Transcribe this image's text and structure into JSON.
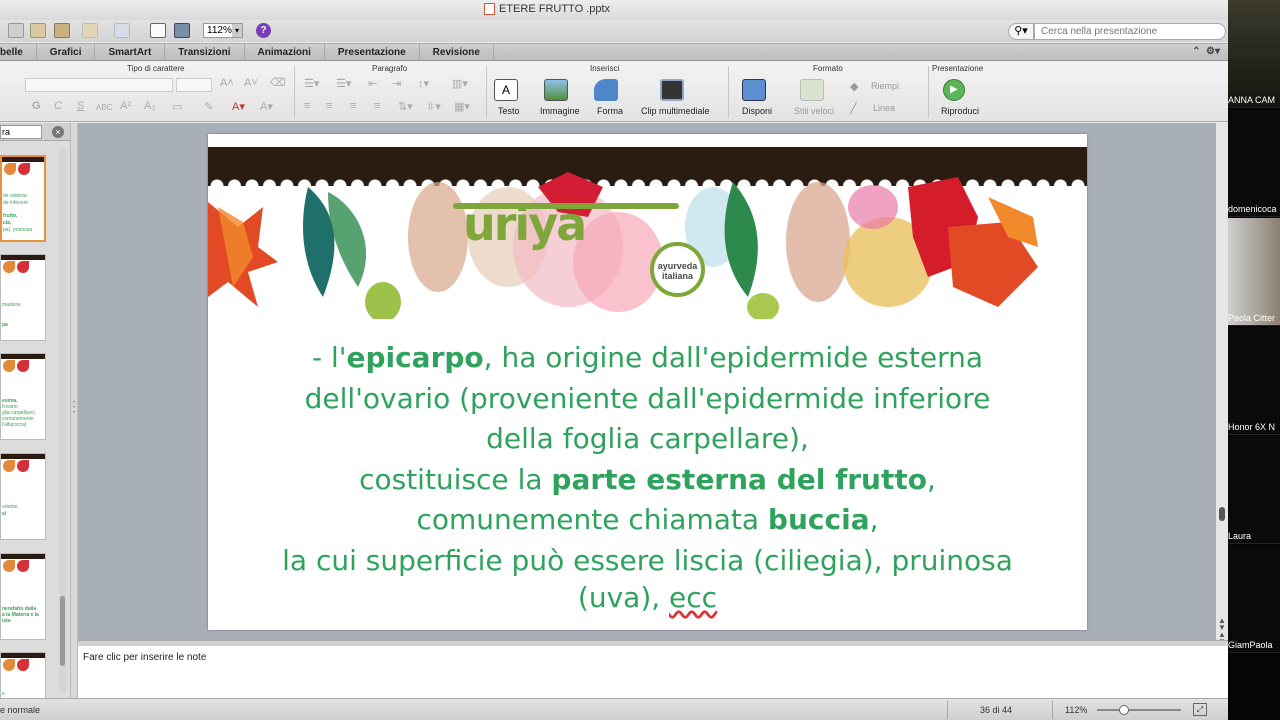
{
  "window": {
    "title": "ETERE FRUTTO .pptx"
  },
  "toolbar": {
    "zoom_value": "112%",
    "help_glyph": "?"
  },
  "search": {
    "placeholder": "Cerca nella presentazione"
  },
  "ribbon_tabs": [
    "belle",
    "Grafici",
    "SmartArt",
    "Transizioni",
    "Animazioni",
    "Presentazione",
    "Revisione"
  ],
  "ribbon": {
    "group_font": "Tipo di carattere",
    "group_paragraph": "Paragrafo",
    "group_insert": "Inserisci",
    "group_format": "Formato",
    "group_show": "Presentazione",
    "btn_text": "Testo",
    "btn_image": "Immagine",
    "btn_shape": "Forma",
    "btn_media": "Clip multimediale",
    "btn_arrange": "Disponi",
    "btn_quick_styles": "Stili veloci",
    "btn_fill": "Riempi",
    "btn_line": "Linea",
    "btn_play": "Riproduci",
    "font_buttons": [
      "G",
      "C",
      "S",
      "ABC",
      "A²",
      "A₂"
    ]
  },
  "left_panel": {
    "tab_label": "ra",
    "close_glyph": "×"
  },
  "slide": {
    "logo_text": "uriya",
    "seal_text_1": "ayurveda",
    "seal_text_2": "italiana",
    "l1a": "- l'",
    "l1b": "epicarpo",
    "l1c": ", ha origine dall'epidermide esterna",
    "l2": "dell'ovario (proveniente dall'epidermide inferiore",
    "l3": "della foglia carpellare),",
    "l4a": "costituisce la ",
    "l4b": "parte esterna del frutto",
    "l4c": ",",
    "l5a": "comunemente chiamata ",
    "l5b": "buccia",
    "l5c": ",",
    "l6": "la cui superficie può essere liscia (ciliegia), pruinosa",
    "l7a": "(uva), ",
    "l7b": "ecc"
  },
  "notes": {
    "placeholder": "Fare clic per inserire le note"
  },
  "status": {
    "view": "e normale",
    "slide_counter": "36 di 44",
    "zoom": "112%",
    "zoom_fraction": 0.3
  },
  "participants": [
    "ANNA CAM",
    "domenicoca",
    "Paola Citter",
    "Honor 6X N",
    "Laura",
    "GiamPaola"
  ],
  "colors": {
    "accent_green": "#2fa35e",
    "logo_green": "#7ea63a",
    "selected_thumb": "#e8913a"
  }
}
